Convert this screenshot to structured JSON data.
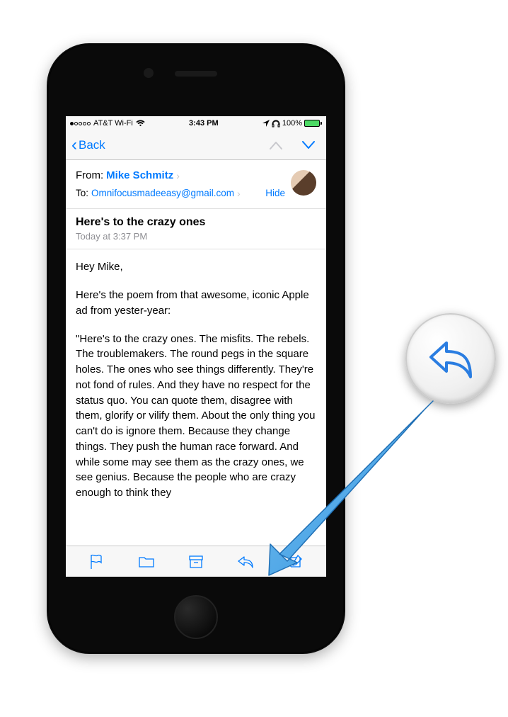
{
  "status": {
    "carrier": "AT&T Wi-Fi",
    "time": "3:43 PM",
    "battery": "100%"
  },
  "nav": {
    "back_label": "Back"
  },
  "header": {
    "from_label": "From:",
    "from_name": "Mike Schmitz",
    "to_label": "To:",
    "to_email": "Omnifocusmadeeasy@gmail.com",
    "hide_label": "Hide"
  },
  "message": {
    "subject": "Here's to the crazy ones",
    "date": "Today at 3:37 PM",
    "greeting": "Hey Mike,",
    "intro": "Here's the poem from that awesome, iconic Apple ad from yester-year:",
    "body": "\"Here's to the crazy ones. The misfits. The rebels. The troublemakers. The round pegs in the square holes. The ones who see things differently. They're not fond of rules. And they have no respect for the status quo. You can quote them, disagree with them, glorify or vilify them. About the only thing you can't do is ignore them. Because they change things. They push the human race forward. And while some may see them as the crazy ones, we see genius. Because the people who are crazy enough to think they"
  },
  "toolbar": {
    "flag": "flag",
    "folder": "folder",
    "archive": "archive",
    "reply": "reply",
    "compose": "compose"
  }
}
